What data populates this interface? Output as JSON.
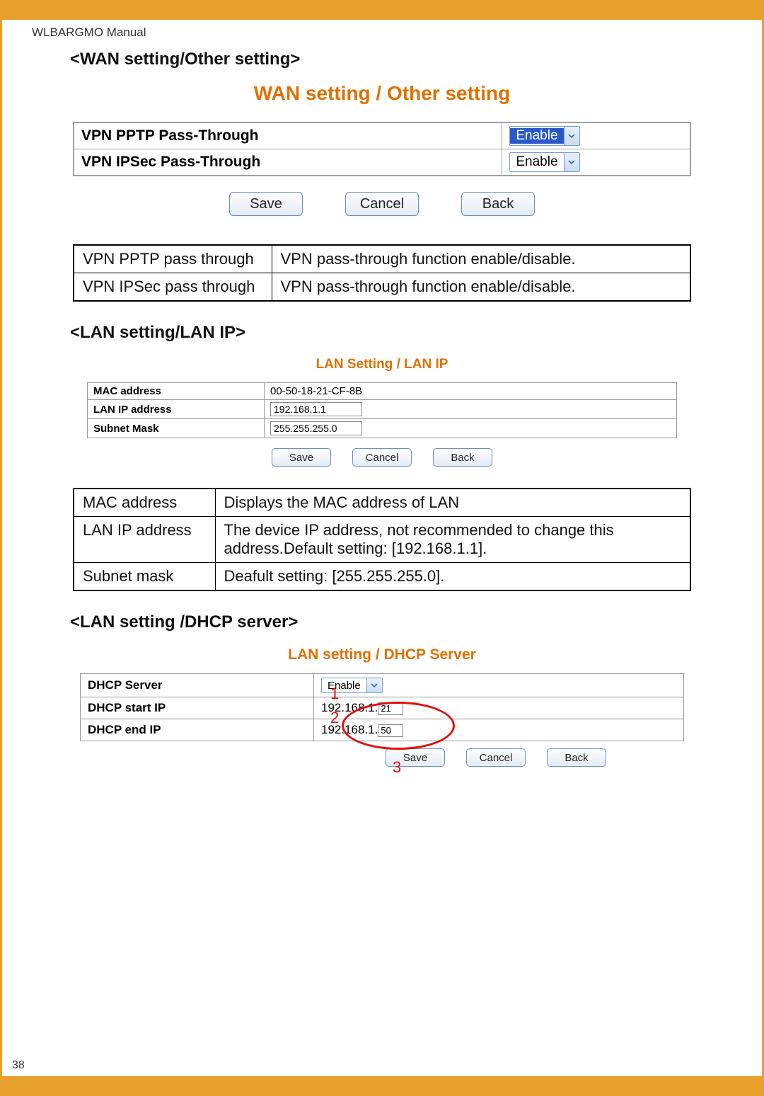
{
  "header": "WLBARGMO Manual",
  "page_number": "38",
  "sections": {
    "wan": {
      "title": "<WAN setting/Other setting>",
      "shot_title": "WAN setting / Other setting",
      "rows": [
        {
          "label": "VPN PPTP Pass-Through",
          "value": "Enable",
          "highlighted": true
        },
        {
          "label": "VPN IPSec Pass-Through",
          "value": "Enable",
          "highlighted": false
        }
      ],
      "buttons": {
        "save": "Save",
        "cancel": "Cancel",
        "back": "Back"
      },
      "desc": [
        {
          "k": "VPN PPTP pass through",
          "v": "VPN pass-through function enable/disable."
        },
        {
          "k": "VPN IPSec pass through",
          "v": "VPN pass-through function enable/disable."
        }
      ]
    },
    "lanip": {
      "title": "<LAN setting/LAN IP>",
      "shot_title": "LAN Setting / LAN IP",
      "rows": [
        {
          "label": "MAC address",
          "value": "00-50-18-21-CF-8B",
          "editable": false
        },
        {
          "label": "LAN IP address",
          "value": "192.168.1.1",
          "editable": true
        },
        {
          "label": "Subnet Mask",
          "value": "255.255.255.0",
          "editable": true
        }
      ],
      "buttons": {
        "save": "Save",
        "cancel": "Cancel",
        "back": "Back"
      },
      "desc": [
        {
          "k": "MAC address",
          "v": "Displays the MAC address of LAN"
        },
        {
          "k": "LAN IP address",
          "v": "The device IP address, not recommended to change this address.Default setting: [192.168.1.1]."
        },
        {
          "k": "Subnet mask",
          "v": "Deafult setting: [255.255.255.0]."
        }
      ]
    },
    "dhcp": {
      "title": "<LAN setting /DHCP server>",
      "shot_title": "LAN setting / DHCP Server",
      "rows": [
        {
          "label": "DHCP Server",
          "value": "Enable",
          "annot": "1"
        },
        {
          "label": "DHCP start IP",
          "prefix": "192.168.1.",
          "value": "21",
          "annot": "2"
        },
        {
          "label": "DHCP end IP",
          "prefix": "192.168.1.",
          "value": "50"
        }
      ],
      "buttons": {
        "save": "Save",
        "cancel": "Cancel",
        "back": "Back"
      },
      "annot3": "3"
    }
  }
}
